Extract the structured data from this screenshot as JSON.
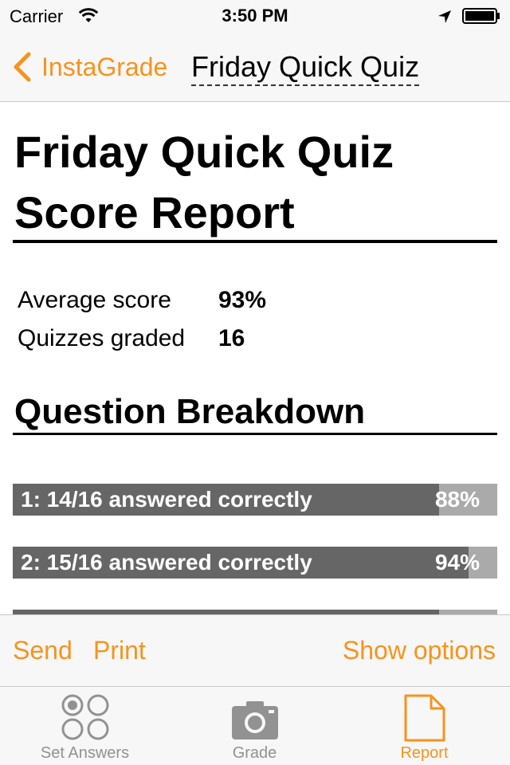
{
  "status_bar": {
    "carrier": "Carrier",
    "time": "3:50 PM",
    "icons": [
      "wifi-icon",
      "location-arrow-icon",
      "battery-icon"
    ]
  },
  "nav": {
    "back_label": "InstaGrade",
    "title": "Friday Quick Quiz",
    "accent_color": "#f7931e"
  },
  "report": {
    "title": "Friday Quick Quiz Score Report",
    "stats": [
      {
        "label": "Average score",
        "value": "93%"
      },
      {
        "label": "Quizzes graded",
        "value": "16"
      }
    ],
    "breakdown_title": "Question Breakdown",
    "questions": [
      {
        "label": "1: 14/16 answered correctly",
        "percent": "88%",
        "fraction": 0.88
      },
      {
        "label": "2: 15/16 answered correctly",
        "percent": "94%",
        "fraction": 0.94
      },
      {
        "label": "",
        "percent": "",
        "fraction": 0.88
      }
    ]
  },
  "toolbar": {
    "send_label": "Send",
    "print_label": "Print",
    "options_label": "Show options"
  },
  "tabs": [
    {
      "label": "Set Answers",
      "icon": "answer-bubbles-icon",
      "active": false
    },
    {
      "label": "Grade",
      "icon": "camera-icon",
      "active": false
    },
    {
      "label": "Report",
      "icon": "document-icon",
      "active": true
    }
  ]
}
